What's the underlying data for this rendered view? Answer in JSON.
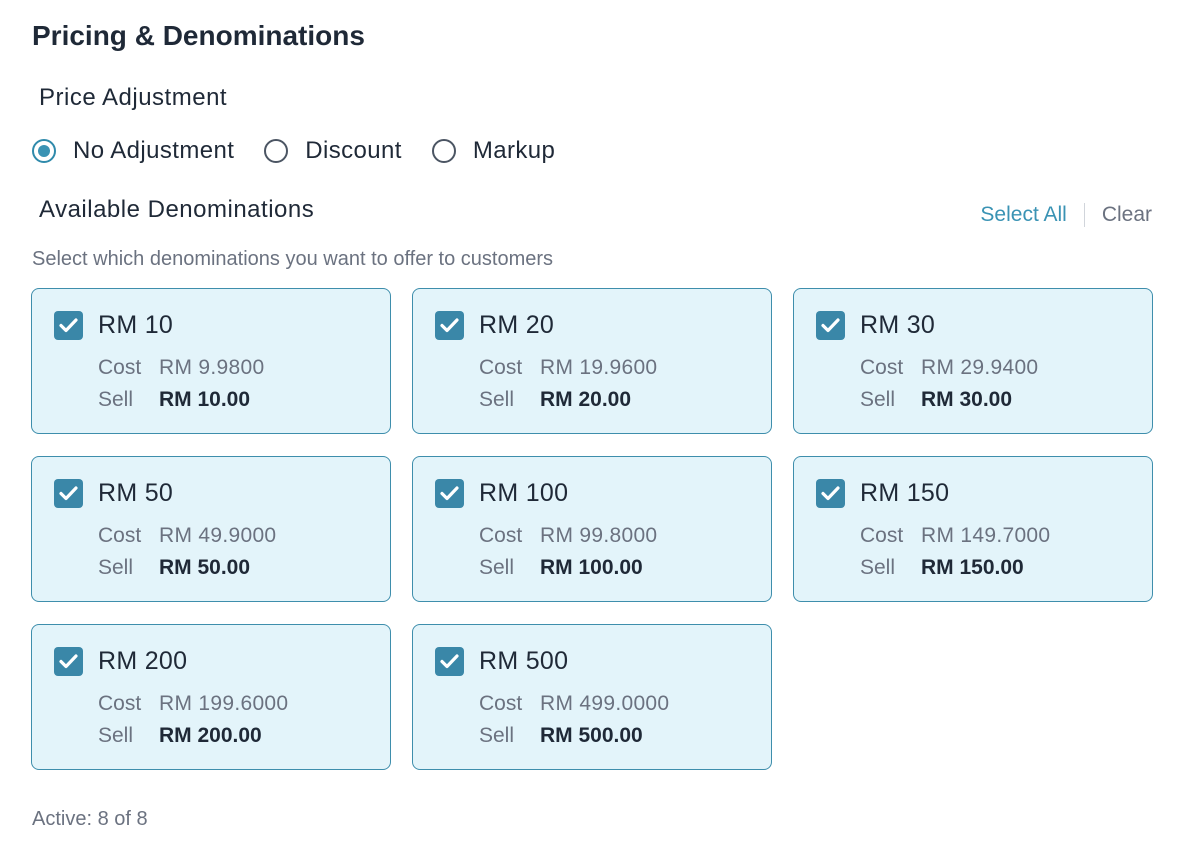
{
  "section": {
    "title": "Pricing & Denominations"
  },
  "price_adjustment": {
    "heading": "Price Adjustment",
    "options": [
      {
        "label": "No Adjustment",
        "selected": true
      },
      {
        "label": "Discount",
        "selected": false
      },
      {
        "label": "Markup",
        "selected": false
      }
    ]
  },
  "denominations": {
    "heading": "Available Denominations",
    "select_all_label": "Select All",
    "clear_label": "Clear",
    "helper_text": "Select which denominations you want to offer to customers",
    "cost_label": "Cost",
    "sell_label": "Sell",
    "items": [
      {
        "name": "RM 10",
        "cost": "RM 9.9800",
        "sell": "RM 10.00",
        "checked": true
      },
      {
        "name": "RM 20",
        "cost": "RM 19.9600",
        "sell": "RM 20.00",
        "checked": true
      },
      {
        "name": "RM 30",
        "cost": "RM 29.9400",
        "sell": "RM 30.00",
        "checked": true
      },
      {
        "name": "RM 50",
        "cost": "RM 49.9000",
        "sell": "RM 50.00",
        "checked": true
      },
      {
        "name": "RM 100",
        "cost": "RM 99.8000",
        "sell": "RM 100.00",
        "checked": true
      },
      {
        "name": "RM 150",
        "cost": "RM 149.7000",
        "sell": "RM 150.00",
        "checked": true
      },
      {
        "name": "RM 200",
        "cost": "RM 199.6000",
        "sell": "RM 200.00",
        "checked": true
      },
      {
        "name": "RM 500",
        "cost": "RM 499.0000",
        "sell": "RM 500.00",
        "checked": true
      }
    ],
    "active_summary": "Active: 8 of 8"
  },
  "colors": {
    "accent": "#3a93b4",
    "card_background": "#e3f4fa",
    "card_border": "#3e8eac",
    "checkbox_fill": "#3a87a8"
  },
  "icons": {
    "checkbox": "checkmark-icon"
  }
}
